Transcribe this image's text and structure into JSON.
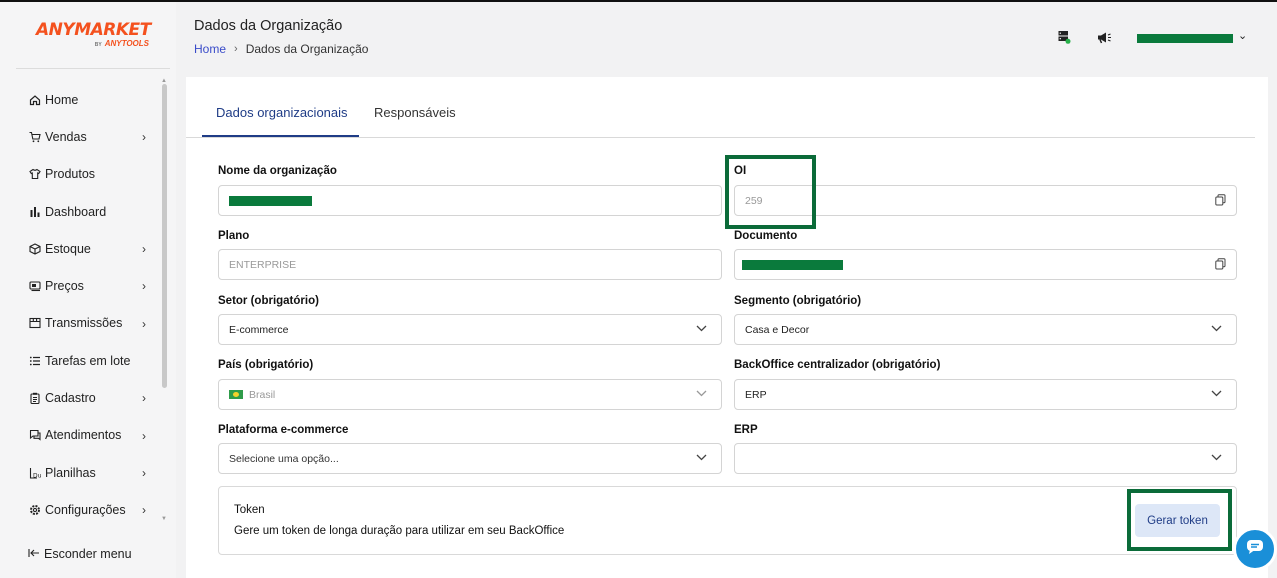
{
  "logo": {
    "brand": "ANYMARKET",
    "by": "BY",
    "sub": "ANYTOOLS"
  },
  "header": {
    "title": "Dados da Organização",
    "breadcrumb": {
      "home": "Home",
      "current": "Dados da Organização"
    }
  },
  "sidebar": {
    "items": [
      {
        "label": "Home",
        "icon": "home-icon",
        "has_submenu": false
      },
      {
        "label": "Vendas",
        "icon": "cart-icon",
        "has_submenu": true
      },
      {
        "label": "Produtos",
        "icon": "shirt-icon",
        "has_submenu": false
      },
      {
        "label": "Dashboard",
        "icon": "bar-chart-icon",
        "has_submenu": false
      },
      {
        "label": "Estoque",
        "icon": "box-icon",
        "has_submenu": true
      },
      {
        "label": "Preços",
        "icon": "price-tag-icon",
        "has_submenu": true
      },
      {
        "label": "Transmissões",
        "icon": "store-icon",
        "has_submenu": true
      },
      {
        "label": "Tarefas em lote",
        "icon": "list-icon",
        "has_submenu": false
      },
      {
        "label": "Cadastro",
        "icon": "clipboard-icon",
        "has_submenu": true
      },
      {
        "label": "Atendimentos",
        "icon": "chat-icon",
        "has_submenu": true
      },
      {
        "label": "Planilhas",
        "icon": "spreadsheet-icon",
        "has_submenu": true
      },
      {
        "label": "Configurações",
        "icon": "gear-icon",
        "has_submenu": true
      }
    ],
    "hide_menu": "Esconder menu"
  },
  "tabs": [
    "Dados organizacionais",
    "Responsáveis"
  ],
  "form": {
    "nome_label": "Nome da organização",
    "oi_label": "OI",
    "oi_value": "259",
    "plano_label": "Plano",
    "plano_value": "ENTERPRISE",
    "documento_label": "Documento",
    "setor_label": "Setor (obrigatório)",
    "setor_value": "E-commerce",
    "segmento_label": "Segmento (obrigatório)",
    "segmento_value": "Casa e Decor",
    "pais_label": "País (obrigatório)",
    "pais_value": "Brasil",
    "backoffice_label": "BackOffice centralizador (obrigatório)",
    "backoffice_value": "ERP",
    "plataforma_label": "Plataforma e-commerce",
    "plataforma_placeholder": "Selecione uma opção...",
    "erp_label": "ERP",
    "erp_value": ""
  },
  "token": {
    "title": "Token",
    "description": "Gere um token de longa duração para utilizar em seu BackOffice",
    "button": "Gerar token"
  },
  "colors": {
    "brand": "#f4511e",
    "accent": "#1f3c86",
    "highlight": "#0b6b39",
    "redaction": "#0a7a3c",
    "chat": "#1a8fd8"
  }
}
